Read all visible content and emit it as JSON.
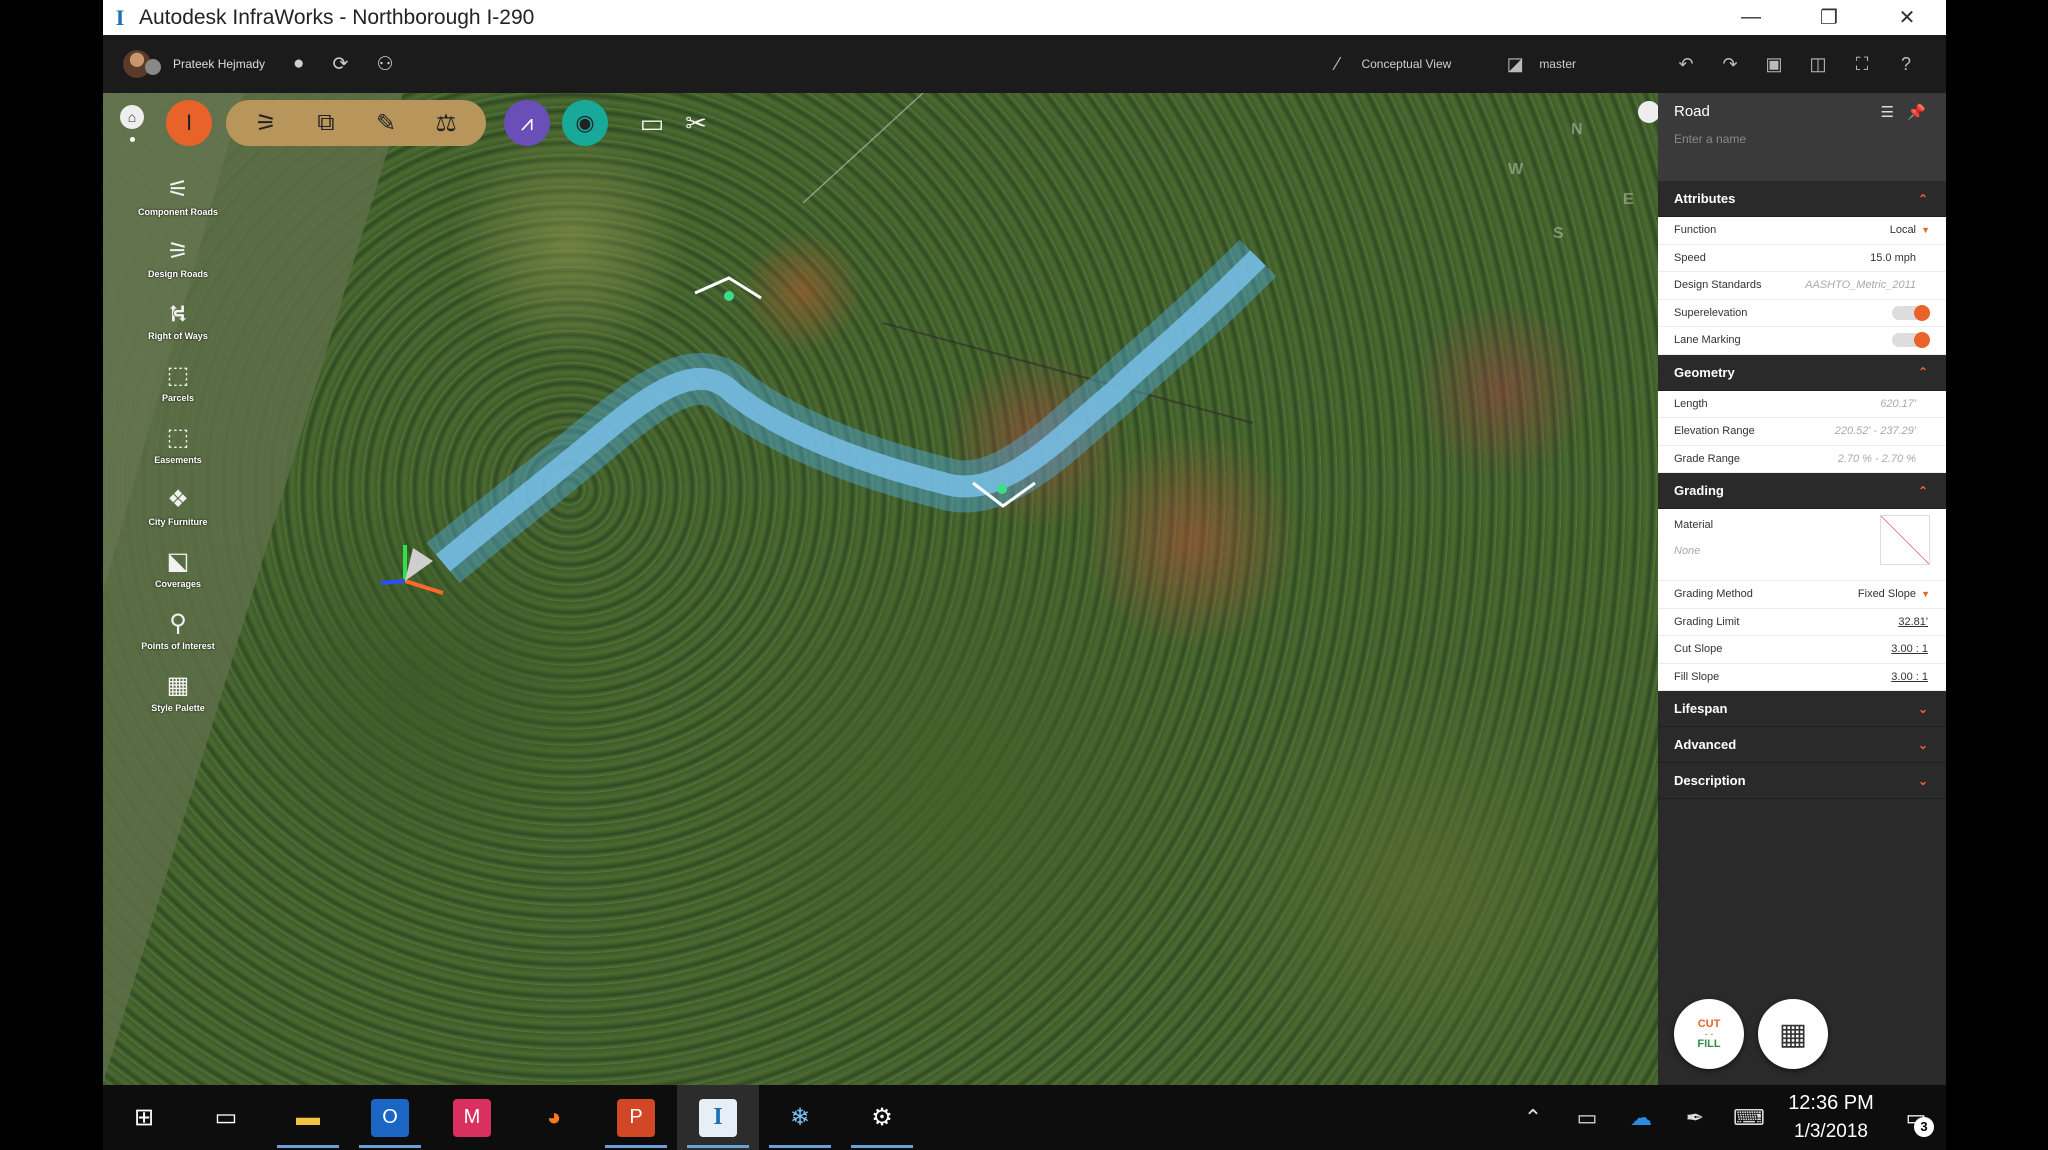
{
  "window": {
    "title": "Autodesk InfraWorks - Northborough I-290",
    "app_icon": "I",
    "controls": {
      "minimize": "—",
      "restore": "❐",
      "close": "✕"
    }
  },
  "appbar": {
    "user_name": "Prateek Hejmady",
    "view_label": "Conceptual View",
    "branch_label": "master"
  },
  "palette": {
    "items": [
      {
        "label": "Component Roads",
        "icon": "component-roads-icon",
        "glyph": "⚟"
      },
      {
        "label": "Design Roads",
        "icon": "design-roads-icon",
        "glyph": "⚞"
      },
      {
        "label": "Right of Ways",
        "icon": "right-of-ways-icon",
        "glyph": "⛕"
      },
      {
        "label": "Parcels",
        "icon": "parcels-icon",
        "glyph": "⬚"
      },
      {
        "label": "Easements",
        "icon": "easements-icon",
        "glyph": "⬚"
      },
      {
        "label": "City Furniture",
        "icon": "city-furniture-icon",
        "glyph": "❖"
      },
      {
        "label": "Coverages",
        "icon": "coverages-icon",
        "glyph": "⬕"
      },
      {
        "label": "Points of Interest",
        "icon": "points-of-interest-icon",
        "glyph": "⚲"
      },
      {
        "label": "Style Palette",
        "icon": "style-palette-icon",
        "glyph": "▦"
      }
    ]
  },
  "compass": {
    "n": "N",
    "w": "W",
    "e": "E",
    "s": "S"
  },
  "panel": {
    "title": "Road",
    "name_placeholder": "Enter a name",
    "sections": {
      "attributes": {
        "label": "Attributes",
        "rows": {
          "function": {
            "label": "Function",
            "value": "Local"
          },
          "speed": {
            "label": "Speed",
            "value": "15.0 mph"
          },
          "design_standards": {
            "label": "Design Standards",
            "value": "AASHTO_Metric_2011"
          },
          "superelevation": {
            "label": "Superelevation"
          },
          "lane_marking": {
            "label": "Lane Marking"
          }
        }
      },
      "geometry": {
        "label": "Geometry",
        "rows": {
          "length": {
            "label": "Length",
            "value": "620.17'"
          },
          "elevation_range": {
            "label": "Elevation Range",
            "value": "220.52' - 237.29'"
          },
          "grade_range": {
            "label": "Grade Range",
            "value": "2.70 % - 2.70 %"
          }
        }
      },
      "grading": {
        "label": "Grading",
        "rows": {
          "material": {
            "label": "Material",
            "value": "None"
          },
          "grading_method": {
            "label": "Grading Method",
            "value": "Fixed Slope"
          },
          "grading_limit": {
            "label": "Grading Limit",
            "value": "32.81'"
          },
          "cut_slope": {
            "label": "Cut Slope",
            "value": "3.00 : 1"
          },
          "fill_slope": {
            "label": "Fill Slope",
            "value": "3.00 : 1"
          }
        }
      },
      "lifespan": {
        "label": "Lifespan"
      },
      "advanced": {
        "label": "Advanced"
      },
      "description": {
        "label": "Description"
      }
    },
    "cut_fill": {
      "cut": "CUT",
      "fill": "FILL"
    },
    "accent": "#e8632a"
  },
  "taskbar": {
    "time": "12:36 PM",
    "date": "1/3/2018",
    "notification_count": "3"
  }
}
